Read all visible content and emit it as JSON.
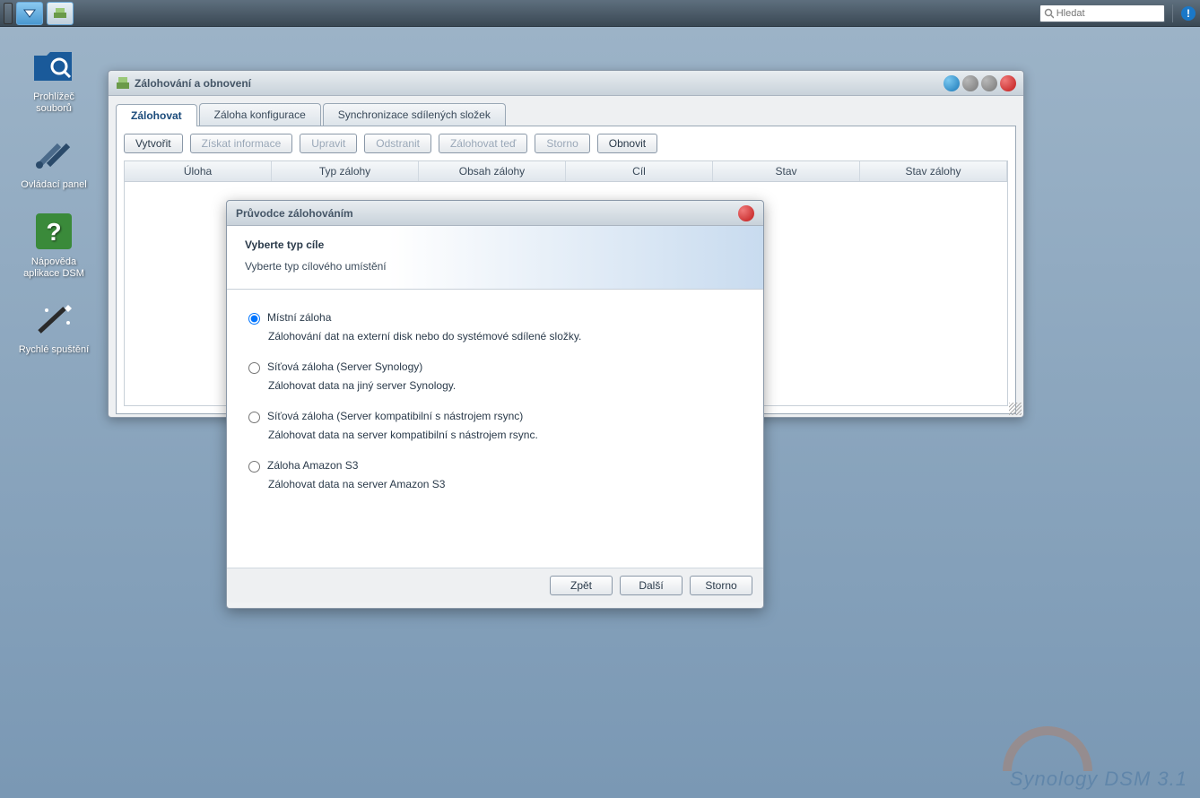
{
  "taskbar": {
    "search_placeholder": "Hledat"
  },
  "desktop": {
    "icons": [
      {
        "label": "Prohlížeč souborů"
      },
      {
        "label": "Ovládací panel"
      },
      {
        "label": "Nápověda aplikace DSM"
      },
      {
        "label": "Rychlé spuštění"
      }
    ]
  },
  "window": {
    "title": "Zálohování a obnovení",
    "tabs": {
      "t0": "Zálohovat",
      "t1": "Záloha konfigurace",
      "t2": "Synchronizace sdílených složek"
    },
    "toolbar": {
      "create": "Vytvořit",
      "info": "Získat informace",
      "edit": "Upravit",
      "delete": "Odstranit",
      "backup_now": "Zálohovat teď",
      "cancel": "Storno",
      "restore": "Obnovit"
    },
    "columns": {
      "c0": "Úloha",
      "c1": "Typ zálohy",
      "c2": "Obsah zálohy",
      "c3": "Cíl",
      "c4": "Stav",
      "c5": "Stav zálohy"
    }
  },
  "dialog": {
    "title": "Průvodce zálohováním",
    "header_title": "Vyberte typ cíle",
    "header_subtitle": "Vyberte typ cílového umístění",
    "options": {
      "o0": {
        "title": "Místní záloha",
        "desc": "Zálohování dat na externí disk nebo do systémové sdílené složky."
      },
      "o1": {
        "title": "Síťová záloha (Server Synology)",
        "desc": "Zálohovat data na jiný server Synology."
      },
      "o2": {
        "title": "Síťová záloha (Server kompatibilní s nástrojem rsync)",
        "desc": "Zálohovat data na server kompatibilní s nástrojem rsync."
      },
      "o3": {
        "title": "Záloha Amazon S3",
        "desc": "Zálohovat data na server Amazon S3"
      }
    },
    "buttons": {
      "back": "Zpět",
      "next": "Další",
      "cancel": "Storno"
    }
  },
  "watermark": "Synology DSM 3.1"
}
